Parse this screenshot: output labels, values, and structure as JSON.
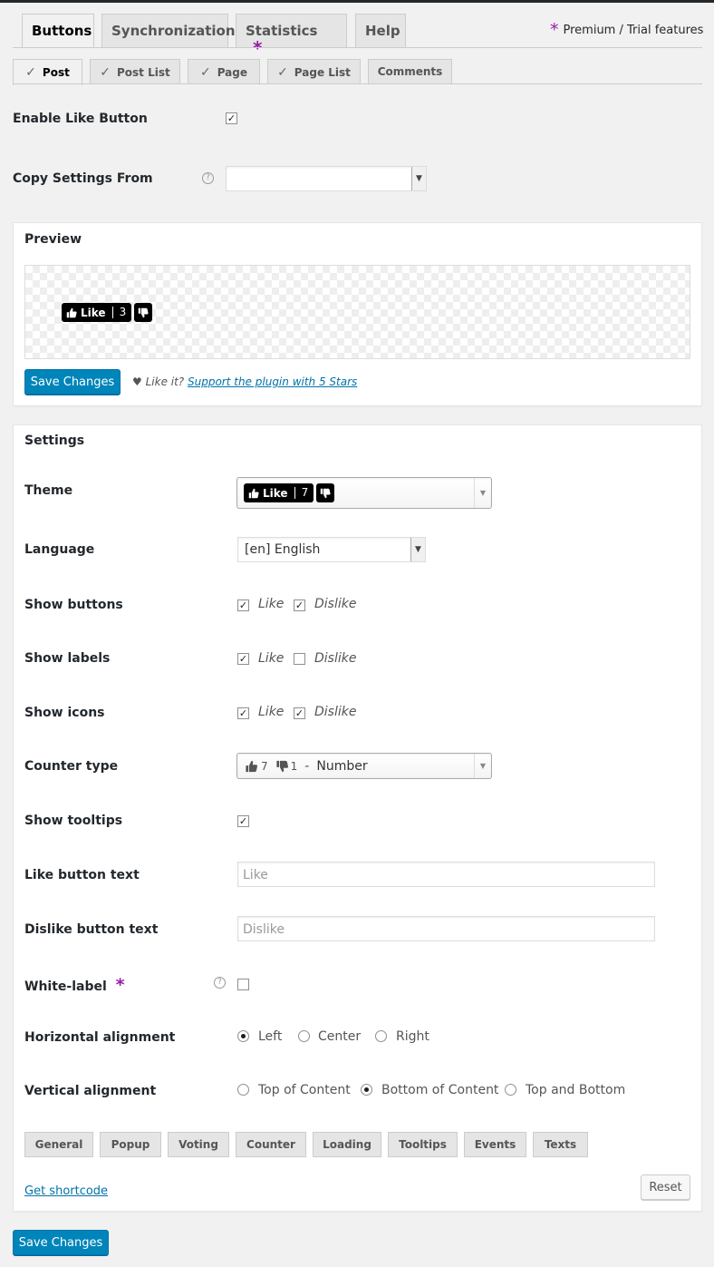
{
  "main_tabs": [
    {
      "label": "Buttons"
    },
    {
      "label": "Synchronization"
    },
    {
      "label": "Statistics"
    },
    {
      "label": "Help"
    }
  ],
  "premium_star": "*",
  "premium_label": "Premium / Trial features",
  "sub_tabs": [
    {
      "label": "Post"
    },
    {
      "label": "Post List"
    },
    {
      "label": "Page"
    },
    {
      "label": "Page List"
    },
    {
      "label": "Comments"
    }
  ],
  "enable_like_button": {
    "label": "Enable Like Button",
    "checked": true
  },
  "copy_settings": {
    "label": "Copy Settings From",
    "value": ""
  },
  "preview": {
    "title": "Preview",
    "like_label": "Like",
    "like_count": "3",
    "save_label": "Save Changes",
    "heart": "♥",
    "like_it": "Like it?",
    "support_link": "Support the plugin with 5 Stars"
  },
  "settings": {
    "title": "Settings",
    "theme": {
      "label": "Theme",
      "like_label": "Like",
      "like_count": "7"
    },
    "language": {
      "label": "Language",
      "value": "[en] English"
    },
    "show_buttons": {
      "label": "Show buttons",
      "like": "Like",
      "dislike": "Dislike",
      "like_checked": true,
      "dislike_checked": true
    },
    "show_labels": {
      "label": "Show labels",
      "like": "Like",
      "dislike": "Dislike",
      "like_checked": true,
      "dislike_checked": false
    },
    "show_icons": {
      "label": "Show icons",
      "like": "Like",
      "dislike": "Dislike",
      "like_checked": true,
      "dislike_checked": true
    },
    "counter_type": {
      "label": "Counter type",
      "like_count": "7",
      "dislike_count": "1",
      "separator": "-",
      "value": "Number"
    },
    "show_tooltips": {
      "label": "Show tooltips",
      "checked": true
    },
    "like_button_text": {
      "label": "Like button text",
      "placeholder": "Like"
    },
    "dislike_button_text": {
      "label": "Dislike button text",
      "placeholder": "Dislike"
    },
    "white_label": {
      "label": "White-label",
      "star": "*",
      "checked": false
    },
    "horizontal_alignment": {
      "label": "Horizontal alignment",
      "options": [
        "Left",
        "Center",
        "Right"
      ],
      "selected": "Left"
    },
    "vertical_alignment": {
      "label": "Vertical alignment",
      "options": [
        "Top of Content",
        "Bottom of Content",
        "Top and Bottom"
      ],
      "selected": "Bottom of Content"
    },
    "bottom_tabs": [
      "General",
      "Popup",
      "Voting",
      "Counter",
      "Loading",
      "Tooltips",
      "Events",
      "Texts"
    ],
    "get_shortcode": "Get shortcode",
    "reset_label": "Reset"
  },
  "footer_save_label": "Save Changes",
  "check_mark": "✓",
  "icons": [
    "thumbs-up-icon",
    "thumbs-down-icon",
    "help-icon",
    "chevron-down-icon",
    "checkmark-icon"
  ],
  "colors": {
    "accent": "#0085ba",
    "premium_star": "#9b1aa8",
    "link": "#0073aa"
  }
}
